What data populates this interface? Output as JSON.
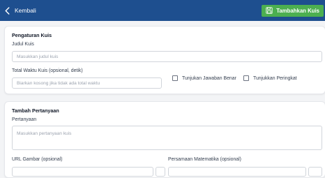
{
  "topbar": {
    "back_label": "Kembali",
    "add_label": "Tambahkan Kuis",
    "bg_color": "#1e4f8f",
    "add_color": "#4caf50"
  },
  "settings": {
    "heading": "Pengaturan Kuis",
    "title_label": "Judul Kuis",
    "title_placeholder": "Masukkan judul kuis",
    "time_label": "Total Waktu Kuis (opsional, detik)",
    "time_placeholder": "Biarkan kosong jika tidak ada total waktu",
    "show_answer_label": "Tunjukan Jawaban Benar",
    "show_rank_label": "Tunjukkan Peringkat"
  },
  "question": {
    "heading": "Tambah Pertanyaan",
    "question_label": "Pertanyaan",
    "question_placeholder": "Masukkan pertanyaan kuis",
    "image_url_label": "URL Gambar (opsional)",
    "math_label": "Persamaan Matematika (opsional)"
  },
  "icons": {
    "back": "chevron-left-icon",
    "add": "save-icon"
  }
}
